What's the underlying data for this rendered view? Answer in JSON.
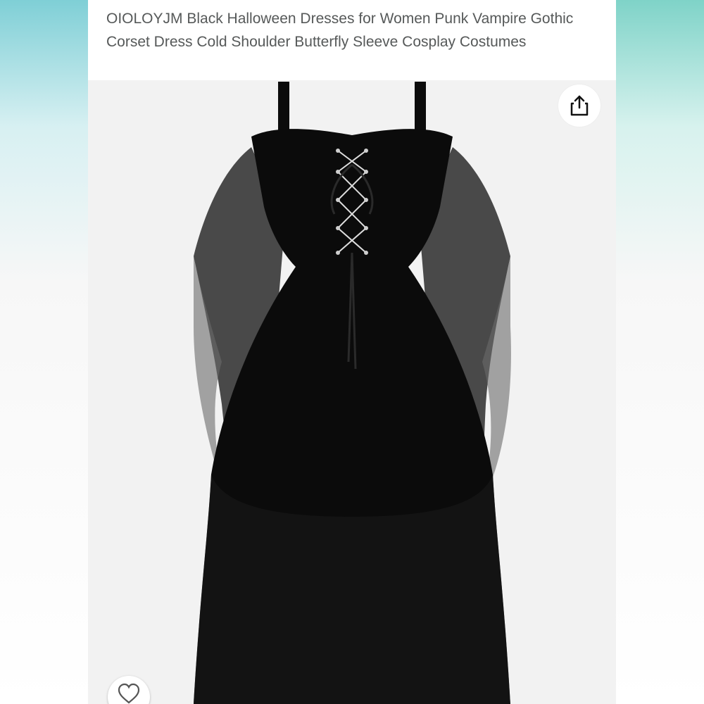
{
  "product": {
    "title": "OIOLOYJM Black Halloween Dresses for Women Punk Vampire Gothic Corset Dress Cold Shoulder Butterfly Sleeve Cosplay Costumes"
  },
  "icons": {
    "share": "share-icon",
    "favorite": "heart-icon"
  },
  "colors": {
    "dress": "#0b0b0b",
    "background": "#f2f2f2"
  }
}
